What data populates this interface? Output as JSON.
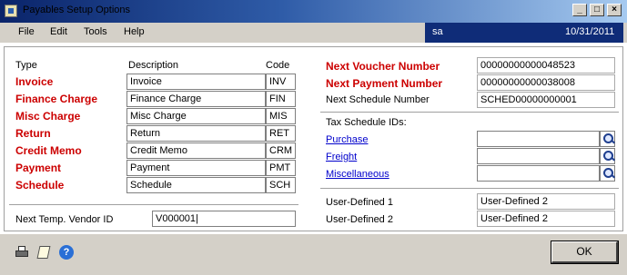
{
  "window": {
    "title": "Payables Setup Options",
    "controls": {
      "minimize": "_",
      "maximize": "□",
      "close": "×"
    }
  },
  "menu": [
    "File",
    "Edit",
    "Tools",
    "Help"
  ],
  "header": {
    "user": "sa",
    "date": "10/31/2011"
  },
  "types_table": {
    "headers": {
      "type": "Type",
      "description": "Description",
      "code": "Code"
    },
    "rows": [
      {
        "type": "Invoice",
        "description": "Invoice",
        "code": "INV"
      },
      {
        "type": "Finance Charge",
        "description": "Finance Charge",
        "code": "FIN"
      },
      {
        "type": "Misc Charge",
        "description": "Misc Charge",
        "code": "MIS"
      },
      {
        "type": "Return",
        "description": "Return",
        "code": "RET"
      },
      {
        "type": "Credit Memo",
        "description": "Credit Memo",
        "code": "CRM"
      },
      {
        "type": "Payment",
        "description": "Payment",
        "code": "PMT"
      },
      {
        "type": "Schedule",
        "description": "Schedule",
        "code": "SCH"
      }
    ]
  },
  "next_temp_vendor": {
    "label": "Next Temp. Vendor ID",
    "value": "V000001|"
  },
  "numbers": {
    "next_voucher": {
      "label": "Next Voucher Number",
      "value": "00000000000048523"
    },
    "next_payment": {
      "label": "Next Payment Number",
      "value": "00000000000038008"
    },
    "next_schedule": {
      "label": "Next Schedule Number",
      "value": "SCHED00000000001"
    }
  },
  "tax_schedules": {
    "label": "Tax Schedule IDs:",
    "items": [
      {
        "label": "Purchase",
        "value": ""
      },
      {
        "label": "Freight",
        "value": ""
      },
      {
        "label": "Miscellaneous",
        "value": ""
      }
    ]
  },
  "user_defined": [
    {
      "label": "User-Defined 1",
      "value": "User-Defined 2"
    },
    {
      "label": "User-Defined 2",
      "value": "User-Defined 2"
    }
  ],
  "buttons": {
    "ok": "OK"
  },
  "icons": {
    "print": "printer-icon",
    "note": "note-icon",
    "help": "help-icon",
    "help_glyph": "?"
  },
  "colors": {
    "required_label": "#cc0000",
    "link": "#0000cc",
    "title_bar": "#0a246a"
  }
}
